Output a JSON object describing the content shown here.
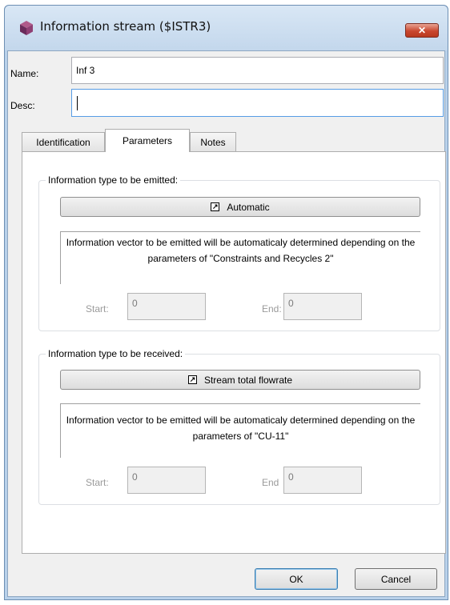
{
  "window": {
    "title": "Information stream ($ISTR3)",
    "close_label": "✕",
    "icon": "app-logo-icon"
  },
  "fields": {
    "name_label": "Name:",
    "name_value": "Inf 3",
    "desc_label": "Desc:",
    "desc_value": ""
  },
  "tabs": [
    {
      "label": "Identification",
      "active": false
    },
    {
      "label": "Parameters",
      "active": true
    },
    {
      "label": "Notes",
      "active": false
    }
  ],
  "emitted": {
    "group_title": "Information type to be emitted:",
    "button_label": "Automatic",
    "description": "Information vector to be emitted will be automaticaly determined depending on the parameters of \"Constraints and Recycles 2\"",
    "start_label": "Start:",
    "start_value": "0",
    "end_label": "End:",
    "end_value": "0"
  },
  "received": {
    "group_title": "Information type to be received:",
    "button_label": "Stream total flowrate",
    "description": "Information vector to be emitted will be automaticaly determined depending on the parameters of \"CU-11\"",
    "start_label": "Start:",
    "start_value": "0",
    "end_label": "End",
    "end_value": "0"
  },
  "buttons": {
    "ok": "OK",
    "cancel": "Cancel"
  },
  "colors": {
    "frame": "#b9d1ea",
    "client": "#f0f0f0",
    "close": "#c9482f",
    "focus": "#569de5"
  }
}
